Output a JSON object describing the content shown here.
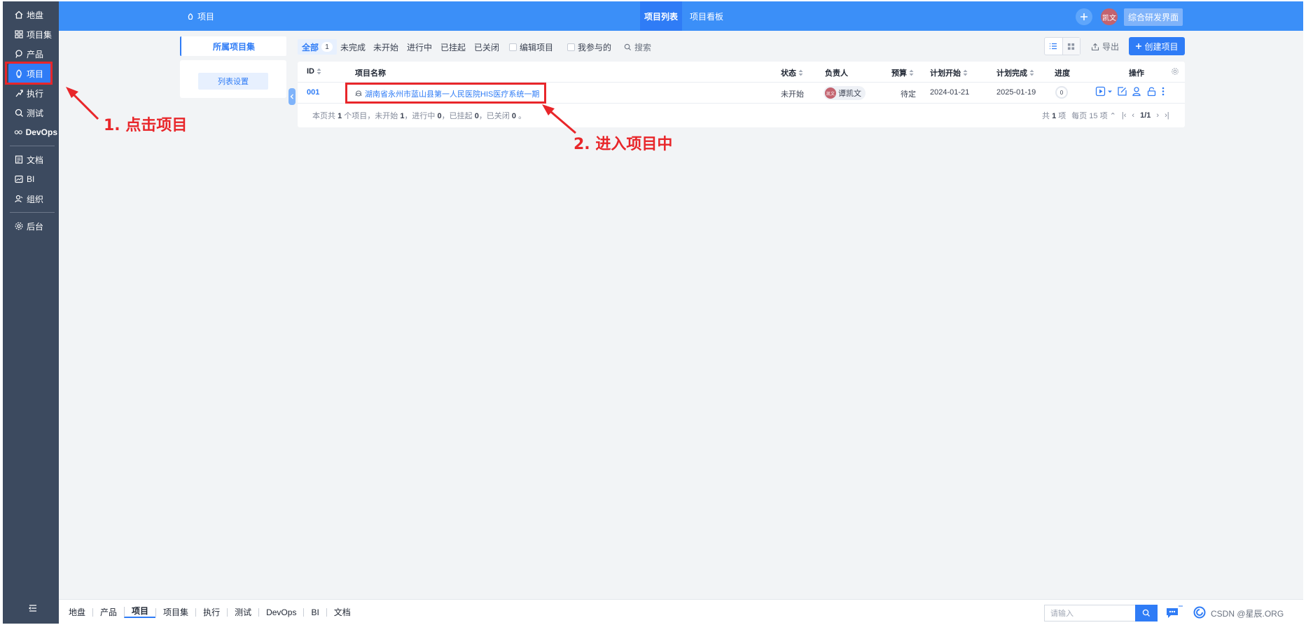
{
  "sidebar": {
    "items": [
      {
        "label": "地盘",
        "icon": "home-icon"
      },
      {
        "label": "项目集",
        "icon": "grid-icon"
      },
      {
        "label": "产品",
        "icon": "product-pin-icon"
      },
      {
        "label": "项目",
        "icon": "project-icon"
      },
      {
        "label": "执行",
        "icon": "run-icon"
      },
      {
        "label": "测试",
        "icon": "test-search-icon"
      },
      {
        "label": "DevOps",
        "icon": "infinity-icon"
      },
      {
        "label": "文档",
        "icon": "document-icon"
      },
      {
        "label": "BI",
        "icon": "chart-icon"
      },
      {
        "label": "组织",
        "icon": "people-icon"
      },
      {
        "label": "后台",
        "icon": "gear-icon"
      }
    ],
    "collapse_icon": "menu-collapse-icon"
  },
  "header": {
    "module_title": "项目",
    "tabs": [
      "项目列表",
      "项目看板"
    ],
    "avatar_text": "凯文",
    "dev_button": "综合研发界面",
    "accent": "#3b8ff8"
  },
  "side_panel": {
    "tab_label": "所属项目集",
    "settings_button": "列表设置"
  },
  "filters": {
    "all_label": "全部",
    "all_count": "1",
    "items": [
      "未完成",
      "未开始",
      "进行中",
      "已挂起",
      "已关闭"
    ],
    "edit_label": "编辑项目",
    "mine_label": "我参与的",
    "search_label": "搜索"
  },
  "toolbar": {
    "export_label": "导出",
    "create_label": "创建项目"
  },
  "table": {
    "columns": [
      "ID",
      "项目名称",
      "状态",
      "负责人",
      "预算",
      "计划开始",
      "计划完成",
      "进度",
      "操作"
    ],
    "rows": [
      {
        "id": "001",
        "name": "湖南省永州市蓝山县第一人民医院HIS医疗系统一期",
        "status": "未开始",
        "owner": "谭凯文",
        "owner_avatar": "凯文",
        "budget": "待定",
        "plan_start": "2024-01-21",
        "plan_end": "2025-01-19",
        "progress": "0",
        "progress_value": 0
      }
    ],
    "summary_prefix": "本页共",
    "summary_total": "1",
    "summary_mid1": "个项目，未开始",
    "summary_wait": "1",
    "summary_mid2": "，进行中",
    "summary_doing": "0",
    "summary_mid3": "，已挂起",
    "summary_suspended": "0",
    "summary_mid4": "，已关闭",
    "summary_closed": "0",
    "summary_end": "。",
    "pager_total_prefix": "共",
    "pager_total": "1",
    "pager_total_suffix": "项",
    "pager_per_page": "每页 15 项",
    "pager_page": "1/1"
  },
  "annotations": {
    "step1": "1. 点击项目",
    "step2": "2. 进入项目中"
  },
  "bottom_bar": {
    "items": [
      "地盘",
      "产品",
      "项目",
      "项目集",
      "执行",
      "测试",
      "DevOps",
      "BI",
      "文档"
    ],
    "active": "项目",
    "search_placeholder": "请输入",
    "info_text": "CSDN @星辰.ORG"
  }
}
